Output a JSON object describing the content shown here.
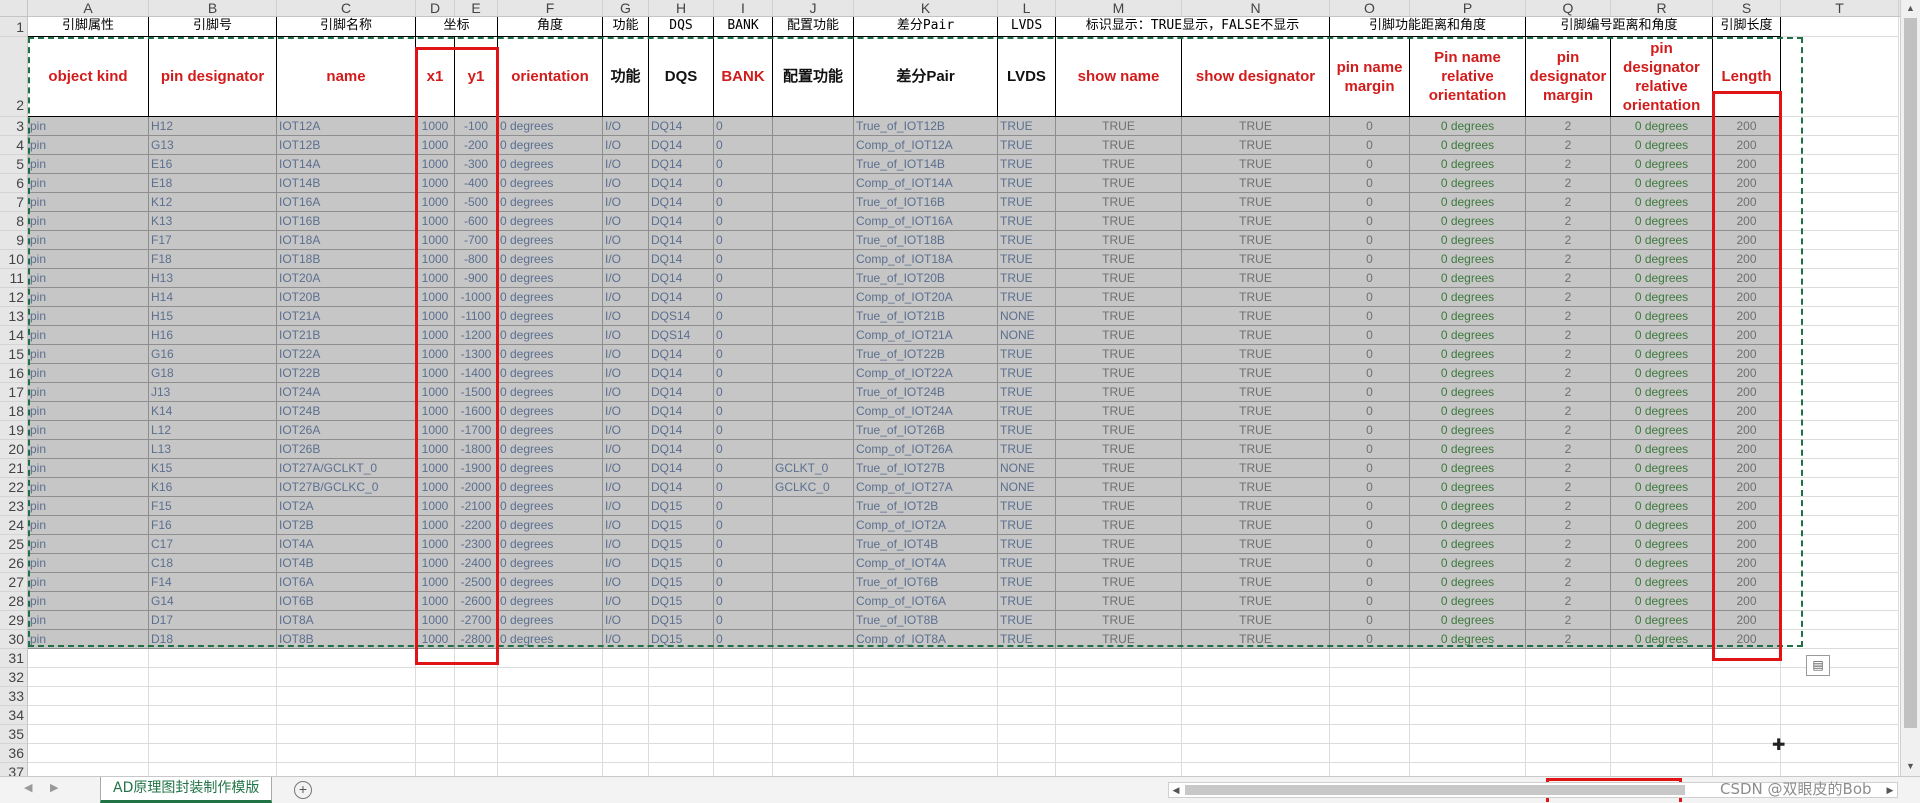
{
  "columns": [
    "A",
    "B",
    "C",
    "D",
    "E",
    "F",
    "G",
    "H",
    "I",
    "J",
    "K",
    "L",
    "M",
    "N",
    "O",
    "P",
    "Q",
    "R",
    "S",
    "T"
  ],
  "row_numbers": [
    "1",
    "2",
    "3",
    "4",
    "5",
    "6",
    "7",
    "8",
    "9",
    "10",
    "11",
    "12",
    "13",
    "14",
    "15",
    "16",
    "17",
    "18",
    "19",
    "20",
    "21",
    "22",
    "23",
    "24",
    "25",
    "26",
    "27",
    "28",
    "29",
    "30",
    "31",
    "32",
    "33",
    "34",
    "35",
    "36",
    "37"
  ],
  "row1": [
    "引脚属性",
    "引脚号",
    "引脚名称",
    "坐标",
    "",
    "角度",
    "功能",
    "DQS",
    "BANK",
    "配置功能",
    "差分Pair",
    "LVDS",
    "标识显示：TRUE显示，FALSE不显示",
    "",
    "引脚功能距离和角度",
    "",
    "引脚编号距离和角度",
    "",
    "引脚长度"
  ],
  "row2": [
    {
      "text": "object kind",
      "color": "red"
    },
    {
      "text": "pin designator",
      "color": "red"
    },
    {
      "text": "name",
      "color": "red"
    },
    {
      "text": "x1",
      "color": "red"
    },
    {
      "text": "y1",
      "color": "red"
    },
    {
      "text": "orientation",
      "color": "red"
    },
    {
      "text": "功能",
      "color": "black"
    },
    {
      "text": "DQS",
      "color": "black"
    },
    {
      "text": "BANK",
      "color": "red"
    },
    {
      "text": "配置功能",
      "color": "black"
    },
    {
      "text": "差分Pair",
      "color": "black"
    },
    {
      "text": "LVDS",
      "color": "black"
    },
    {
      "text": "show name",
      "color": "red"
    },
    {
      "text": "show designator",
      "color": "red"
    },
    {
      "text": "pin name margin",
      "color": "red"
    },
    {
      "text": "Pin name relative orientation",
      "color": "red"
    },
    {
      "text": "pin designator margin",
      "color": "red"
    },
    {
      "text": "pin designator relative orientation",
      "color": "red"
    },
    {
      "text": "Length",
      "color": "red"
    }
  ],
  "rows": [
    [
      "pin",
      "H12",
      "IOT12A",
      "1000",
      "-100",
      "0 degrees",
      "I/O",
      "DQ14",
      "0",
      "",
      "True_of_IOT12B",
      "TRUE",
      "TRUE",
      "TRUE",
      "0",
      "0 degrees",
      "2",
      "0 degrees",
      "200"
    ],
    [
      "pin",
      "G13",
      "IOT12B",
      "1000",
      "-200",
      "0 degrees",
      "I/O",
      "DQ14",
      "0",
      "",
      "Comp_of_IOT12A",
      "TRUE",
      "TRUE",
      "TRUE",
      "0",
      "0 degrees",
      "2",
      "0 degrees",
      "200"
    ],
    [
      "pin",
      "E16",
      "IOT14A",
      "1000",
      "-300",
      "0 degrees",
      "I/O",
      "DQ14",
      "0",
      "",
      "True_of_IOT14B",
      "TRUE",
      "TRUE",
      "TRUE",
      "0",
      "0 degrees",
      "2",
      "0 degrees",
      "200"
    ],
    [
      "pin",
      "E18",
      "IOT14B",
      "1000",
      "-400",
      "0 degrees",
      "I/O",
      "DQ14",
      "0",
      "",
      "Comp_of_IOT14A",
      "TRUE",
      "TRUE",
      "TRUE",
      "0",
      "0 degrees",
      "2",
      "0 degrees",
      "200"
    ],
    [
      "pin",
      "K12",
      "IOT16A",
      "1000",
      "-500",
      "0 degrees",
      "I/O",
      "DQ14",
      "0",
      "",
      "True_of_IOT16B",
      "TRUE",
      "TRUE",
      "TRUE",
      "0",
      "0 degrees",
      "2",
      "0 degrees",
      "200"
    ],
    [
      "pin",
      "K13",
      "IOT16B",
      "1000",
      "-600",
      "0 degrees",
      "I/O",
      "DQ14",
      "0",
      "",
      "Comp_of_IOT16A",
      "TRUE",
      "TRUE",
      "TRUE",
      "0",
      "0 degrees",
      "2",
      "0 degrees",
      "200"
    ],
    [
      "pin",
      "F17",
      "IOT18A",
      "1000",
      "-700",
      "0 degrees",
      "I/O",
      "DQ14",
      "0",
      "",
      "True_of_IOT18B",
      "TRUE",
      "TRUE",
      "TRUE",
      "0",
      "0 degrees",
      "2",
      "0 degrees",
      "200"
    ],
    [
      "pin",
      "F18",
      "IOT18B",
      "1000",
      "-800",
      "0 degrees",
      "I/O",
      "DQ14",
      "0",
      "",
      "Comp_of_IOT18A",
      "TRUE",
      "TRUE",
      "TRUE",
      "0",
      "0 degrees",
      "2",
      "0 degrees",
      "200"
    ],
    [
      "pin",
      "H13",
      "IOT20A",
      "1000",
      "-900",
      "0 degrees",
      "I/O",
      "DQ14",
      "0",
      "",
      "True_of_IOT20B",
      "TRUE",
      "TRUE",
      "TRUE",
      "0",
      "0 degrees",
      "2",
      "0 degrees",
      "200"
    ],
    [
      "pin",
      "H14",
      "IOT20B",
      "1000",
      "-1000",
      "0 degrees",
      "I/O",
      "DQ14",
      "0",
      "",
      "Comp_of_IOT20A",
      "TRUE",
      "TRUE",
      "TRUE",
      "0",
      "0 degrees",
      "2",
      "0 degrees",
      "200"
    ],
    [
      "pin",
      "H15",
      "IOT21A",
      "1000",
      "-1100",
      "0 degrees",
      "I/O",
      "DQS14",
      "0",
      "",
      "True_of_IOT21B",
      "NONE",
      "TRUE",
      "TRUE",
      "0",
      "0 degrees",
      "2",
      "0 degrees",
      "200"
    ],
    [
      "pin",
      "H16",
      "IOT21B",
      "1000",
      "-1200",
      "0 degrees",
      "I/O",
      "DQS14",
      "0",
      "",
      "Comp_of_IOT21A",
      "NONE",
      "TRUE",
      "TRUE",
      "0",
      "0 degrees",
      "2",
      "0 degrees",
      "200"
    ],
    [
      "pin",
      "G16",
      "IOT22A",
      "1000",
      "-1300",
      "0 degrees",
      "I/O",
      "DQ14",
      "0",
      "",
      "True_of_IOT22B",
      "TRUE",
      "TRUE",
      "TRUE",
      "0",
      "0 degrees",
      "2",
      "0 degrees",
      "200"
    ],
    [
      "pin",
      "G18",
      "IOT22B",
      "1000",
      "-1400",
      "0 degrees",
      "I/O",
      "DQ14",
      "0",
      "",
      "Comp_of_IOT22A",
      "TRUE",
      "TRUE",
      "TRUE",
      "0",
      "0 degrees",
      "2",
      "0 degrees",
      "200"
    ],
    [
      "pin",
      "J13",
      "IOT24A",
      "1000",
      "-1500",
      "0 degrees",
      "I/O",
      "DQ14",
      "0",
      "",
      "True_of_IOT24B",
      "TRUE",
      "TRUE",
      "TRUE",
      "0",
      "0 degrees",
      "2",
      "0 degrees",
      "200"
    ],
    [
      "pin",
      "K14",
      "IOT24B",
      "1000",
      "-1600",
      "0 degrees",
      "I/O",
      "DQ14",
      "0",
      "",
      "Comp_of_IOT24A",
      "TRUE",
      "TRUE",
      "TRUE",
      "0",
      "0 degrees",
      "2",
      "0 degrees",
      "200"
    ],
    [
      "pin",
      "L12",
      "IOT26A",
      "1000",
      "-1700",
      "0 degrees",
      "I/O",
      "DQ14",
      "0",
      "",
      "True_of_IOT26B",
      "TRUE",
      "TRUE",
      "TRUE",
      "0",
      "0 degrees",
      "2",
      "0 degrees",
      "200"
    ],
    [
      "pin",
      "L13",
      "IOT26B",
      "1000",
      "-1800",
      "0 degrees",
      "I/O",
      "DQ14",
      "0",
      "",
      "Comp_of_IOT26A",
      "TRUE",
      "TRUE",
      "TRUE",
      "0",
      "0 degrees",
      "2",
      "0 degrees",
      "200"
    ],
    [
      "pin",
      "K15",
      "IOT27A/GCLKT_0",
      "1000",
      "-1900",
      "0 degrees",
      "I/O",
      "DQ14",
      "0",
      "GCLKT_0",
      "True_of_IOT27B",
      "NONE",
      "TRUE",
      "TRUE",
      "0",
      "0 degrees",
      "2",
      "0 degrees",
      "200"
    ],
    [
      "pin",
      "K16",
      "IOT27B/GCLKC_0",
      "1000",
      "-2000",
      "0 degrees",
      "I/O",
      "DQ14",
      "0",
      "GCLKC_0",
      "Comp_of_IOT27A",
      "NONE",
      "TRUE",
      "TRUE",
      "0",
      "0 degrees",
      "2",
      "0 degrees",
      "200"
    ],
    [
      "pin",
      "F15",
      "IOT2A",
      "1000",
      "-2100",
      "0 degrees",
      "I/O",
      "DQ15",
      "0",
      "",
      "True_of_IOT2B",
      "TRUE",
      "TRUE",
      "TRUE",
      "0",
      "0 degrees",
      "2",
      "0 degrees",
      "200"
    ],
    [
      "pin",
      "F16",
      "IOT2B",
      "1000",
      "-2200",
      "0 degrees",
      "I/O",
      "DQ15",
      "0",
      "",
      "Comp_of_IOT2A",
      "TRUE",
      "TRUE",
      "TRUE",
      "0",
      "0 degrees",
      "2",
      "0 degrees",
      "200"
    ],
    [
      "pin",
      "C17",
      "IOT4A",
      "1000",
      "-2300",
      "0 degrees",
      "I/O",
      "DQ15",
      "0",
      "",
      "True_of_IOT4B",
      "TRUE",
      "TRUE",
      "TRUE",
      "0",
      "0 degrees",
      "2",
      "0 degrees",
      "200"
    ],
    [
      "pin",
      "C18",
      "IOT4B",
      "1000",
      "-2400",
      "0 degrees",
      "I/O",
      "DQ15",
      "0",
      "",
      "Comp_of_IOT4A",
      "TRUE",
      "TRUE",
      "TRUE",
      "0",
      "0 degrees",
      "2",
      "0 degrees",
      "200"
    ],
    [
      "pin",
      "F14",
      "IOT6A",
      "1000",
      "-2500",
      "0 degrees",
      "I/O",
      "DQ15",
      "0",
      "",
      "True_of_IOT6B",
      "TRUE",
      "TRUE",
      "TRUE",
      "0",
      "0 degrees",
      "2",
      "0 degrees",
      "200"
    ],
    [
      "pin",
      "G14",
      "IOT6B",
      "1000",
      "-2600",
      "0 degrees",
      "I/O",
      "DQ15",
      "0",
      "",
      "Comp_of_IOT6A",
      "TRUE",
      "TRUE",
      "TRUE",
      "0",
      "0 degrees",
      "2",
      "0 degrees",
      "200"
    ],
    [
      "pin",
      "D17",
      "IOT8A",
      "1000",
      "-2700",
      "0 degrees",
      "I/O",
      "DQ15",
      "0",
      "",
      "True_of_IOT8B",
      "TRUE",
      "TRUE",
      "TRUE",
      "0",
      "0 degrees",
      "2",
      "0 degrees",
      "200"
    ],
    [
      "pin",
      "D18",
      "IOT8B",
      "1000",
      "-2800",
      "0 degrees",
      "I/O",
      "DQ15",
      "0",
      "",
      "Comp_of_IOT8A",
      "TRUE",
      "TRUE",
      "TRUE",
      "0",
      "0 degrees",
      "2",
      "0 degrees",
      "200"
    ]
  ],
  "sheet_tab": "AD原理图封装制作模版",
  "add_sheet": "+",
  "watermark": "CSDN @双眼皮的Bob",
  "colors": {
    "header_red": "#d21c1c",
    "data_fill": "#c6c6c6",
    "selection_green": "#1e7145",
    "highlight_red": "#e01414"
  },
  "icons": {
    "paste_options": "clipboard-icon",
    "cursor": "crosshair-cursor-icon",
    "add_sheet": "plus-circle-icon"
  }
}
